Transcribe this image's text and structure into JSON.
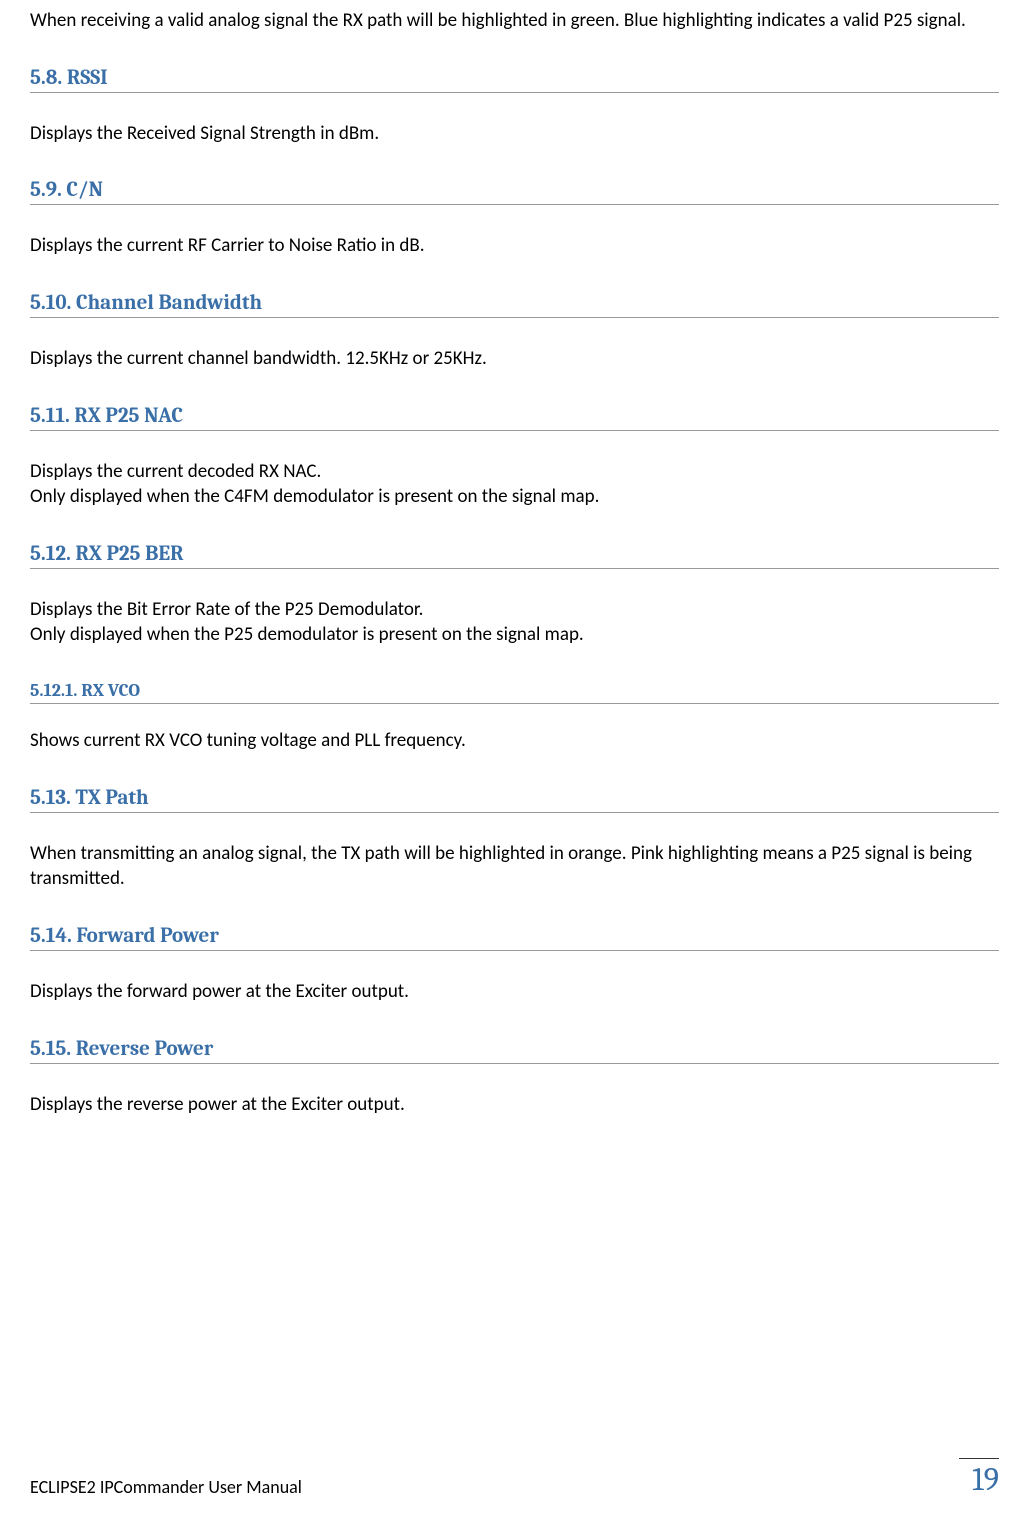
{
  "intro_text": "When receiving a valid analog signal the RX path will be highlighted in green.  Blue highlighting indicates a valid P25 signal.",
  "sections": {
    "rssi": {
      "heading": "5.8. RSSI",
      "body": "Displays the Received Signal Strength in dBm."
    },
    "cn": {
      "heading": "5.9. C/N",
      "body": "Displays the current RF Carrier to Noise Ratio in dB."
    },
    "channel_bandwidth": {
      "heading": "5.10. Channel Bandwidth",
      "body": "Displays the current channel bandwidth. 12.5KHz or 25KHz."
    },
    "rx_p25_nac": {
      "heading": "5.11. RX P25 NAC",
      "body_line1": "Displays the current decoded RX NAC.",
      "body_line2": "Only displayed when the C4FM demodulator is present on the signal map."
    },
    "rx_p25_ber": {
      "heading": "5.12. RX P25 BER",
      "body_line1": "Displays the Bit Error Rate of the P25 Demodulator.",
      "body_line2": "Only displayed when the P25 demodulator is present on the signal map."
    },
    "rx_vco": {
      "heading": "5.12.1. RX VCO",
      "body": "Shows current RX VCO tuning voltage and PLL frequency."
    },
    "tx_path": {
      "heading": "5.13. TX Path",
      "body": "When transmitting an analog signal, the TX path will be highlighted in orange.  Pink highlighting means a P25 signal is being transmitted."
    },
    "forward_power": {
      "heading": "5.14. Forward Power",
      "body": "Displays the forward power at the Exciter output."
    },
    "reverse_power": {
      "heading": "5.15. Reverse Power",
      "body": "Displays the reverse power at the Exciter output."
    }
  },
  "footer": {
    "text": "ECLIPSE2 IPCommander User Manual",
    "page_number": "19"
  }
}
